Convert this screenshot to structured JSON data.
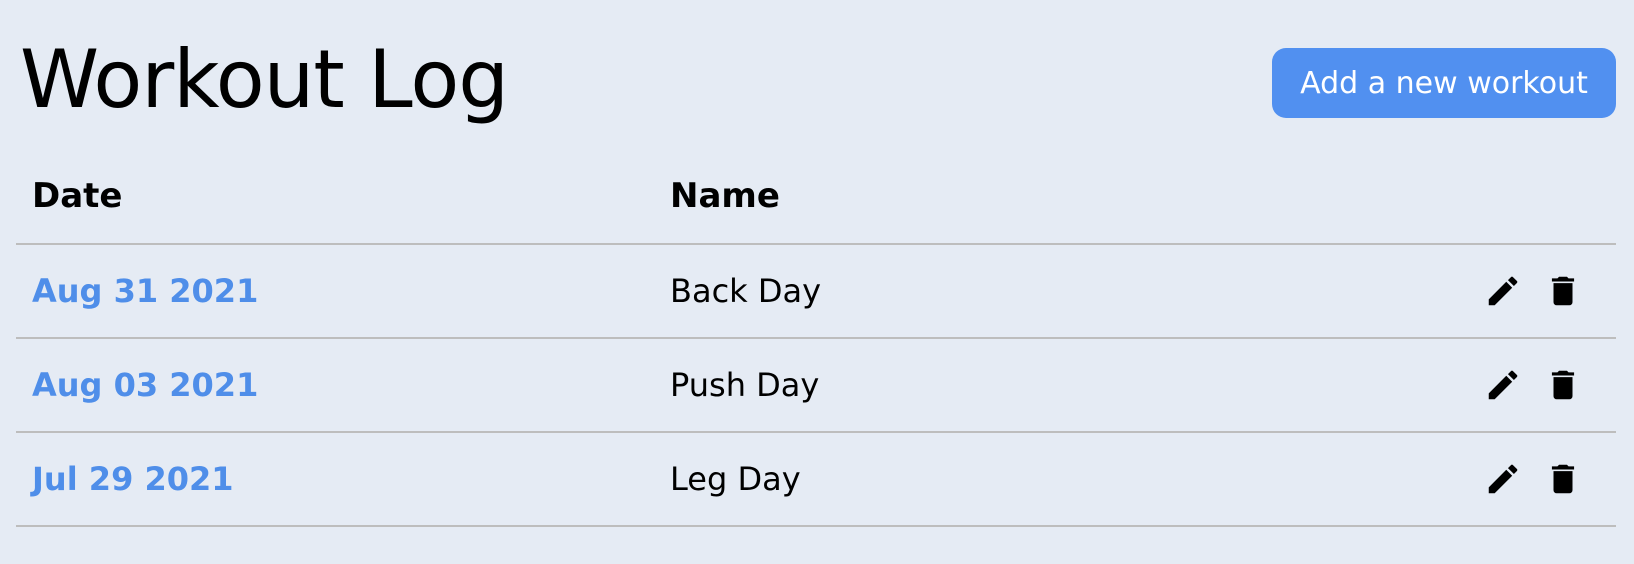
{
  "header": {
    "title": "Workout Log",
    "add_button_label": "Add a new workout"
  },
  "table": {
    "columns": {
      "date": "Date",
      "name": "Name"
    },
    "rows": [
      {
        "date": "Aug 31 2021",
        "name": "Back Day",
        "edit_icon": "pencil-icon",
        "delete_icon": "trash-icon"
      },
      {
        "date": "Aug 03 2021",
        "name": "Push Day",
        "edit_icon": "pencil-icon",
        "delete_icon": "trash-icon"
      },
      {
        "date": "Jul 29 2021",
        "name": "Leg Day",
        "edit_icon": "pencil-icon",
        "delete_icon": "trash-icon"
      }
    ]
  },
  "colors": {
    "background": "#e5ebf4",
    "accent": "#5190f0",
    "date_link": "#4f8ee9",
    "divider": "#bdbdbd"
  }
}
